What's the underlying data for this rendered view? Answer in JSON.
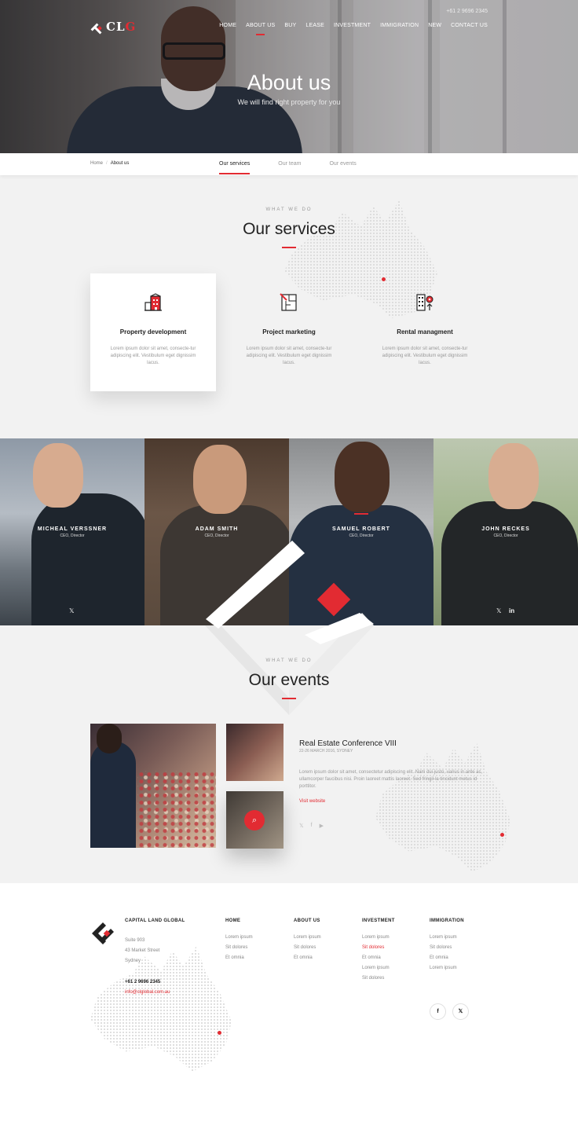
{
  "brand": {
    "logo_text": "CL",
    "logo_accent": "G",
    "accent_color": "#e22b32"
  },
  "header": {
    "phone": "+61 2 9696 2345",
    "nav": [
      "HOME",
      "ABOUT US",
      "BUY",
      "LEASE",
      "INVESTMENT",
      "IMMIGRATION",
      "NEW",
      "CONTACT US"
    ],
    "active_nav": "ABOUT US",
    "title": "About us",
    "subtitle": "We will find right property for you"
  },
  "subbar": {
    "breadcrumb": {
      "home": "Home",
      "separator": "/",
      "current": "About us"
    },
    "tabs": [
      "Our services",
      "Our team",
      "Our events"
    ],
    "active_tab": "Our services"
  },
  "services": {
    "eyebrow": "WHAT WE DO",
    "title": "Our services",
    "items": [
      {
        "title": "Property development",
        "text": "Lorem ipsum dolor sit amet, consecte-tur adipiscing elit. Vestibulum eget dignissim lacus.",
        "icon": "building-icon"
      },
      {
        "title": "Project marketing",
        "text": "Lorem ipsum dolor sit amet, consecte-tur adipiscing elit. Vestibulum eget dignissim lacus.",
        "icon": "blueprint-icon"
      },
      {
        "title": "Rental managment",
        "text": "Lorem ipsum dolor sit amet, consecte-tur adipiscing elit. Vestibulum eget dignissim lacus.",
        "icon": "office-location-icon"
      }
    ]
  },
  "team": [
    {
      "name": "MICHEAL VERSSNER",
      "role": "CEO, Director"
    },
    {
      "name": "ADAM SMITH",
      "role": "CEO, Director"
    },
    {
      "name": "SAMUEL ROBERT",
      "role": "CEO, Director"
    },
    {
      "name": "JOHN RECKES",
      "role": "CEO, Director"
    }
  ],
  "events": {
    "eyebrow": "WHAT WE DO",
    "title": "Our events",
    "event_title": "Real Estate Conference VIII",
    "event_date": "22-26 MARCH 2016, SYDNEY",
    "event_text": "Lorem ipsum dolor sit amet, consectetur adipiscing elit. Nam dui justo, varius in ante ac, ullamcorper faucibus nisi. Proin laoreet mattis laoreet. Sed fringil-la tincidunt metus id porttitor.",
    "link": "Visit website",
    "social": [
      "twitter-icon",
      "facebook-icon",
      "youtube-icon"
    ]
  },
  "footer": {
    "company": "CAPITAL LAND GLOBAL",
    "address": [
      "Suite 903",
      "43 Market Street",
      "Sydney"
    ],
    "phone": "+61 2 9696 2345",
    "email": "info@clglobal.com.au",
    "columns": [
      {
        "title": "HOME",
        "links": [
          "Lorem ipsum",
          "Sit dolores",
          "Et omnia"
        ]
      },
      {
        "title": "ABOUT US",
        "links": [
          "Lorem ipsum",
          "Sit dolores",
          "Et omnia"
        ]
      },
      {
        "title": "INVESTMENT",
        "links": [
          "Lorem ipsum",
          "Sit dolores",
          "Et omnia",
          "Lorem ipsum",
          "Sit dolores"
        ],
        "highlight": 1
      },
      {
        "title": "IMMIGRATION",
        "links": [
          "Lorem ipsum",
          "Sit dolores",
          "Et omnia",
          "Lorem ipsum"
        ]
      }
    ],
    "social": [
      "facebook-icon",
      "twitter-icon"
    ]
  }
}
